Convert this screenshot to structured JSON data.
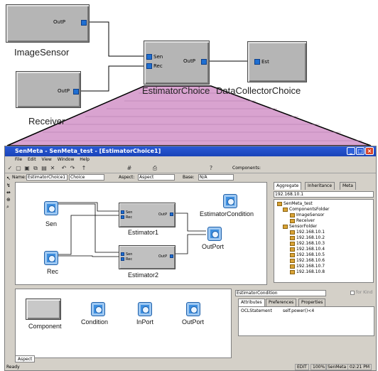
{
  "top_diagram": {
    "image_sensor": {
      "port": "OutP",
      "label": "ImageSensor"
    },
    "receiver": {
      "port": "OutP",
      "label": "Receiver"
    },
    "estimator_choice": {
      "ports_in": [
        "Sen",
        "Rec"
      ],
      "port_out": "OutP",
      "label": "EstimatorChoice"
    },
    "data_collector": {
      "port": "Est",
      "label": "DataCollectorChoice"
    }
  },
  "window": {
    "title": "SenMeta - SenMeta_test - [EstimatorChoice1]",
    "menu": [
      "File",
      "Edit",
      "View",
      "Window",
      "Help"
    ],
    "components_label": "Components:",
    "name_label": "Name:",
    "name_value": "EstimatorChoice1",
    "kind_value": "Choice",
    "aspect_label": "Aspect:",
    "aspect_value": "Aspect",
    "base_label": "Base:",
    "base_value": "N/A"
  },
  "canvas": {
    "nodes": [
      {
        "label": "Sen"
      },
      {
        "label": "Rec"
      },
      {
        "label": "EstimatorCondition"
      },
      {
        "label": "OutPort"
      }
    ],
    "estimator1": {
      "label": "Estimator1",
      "in": [
        "Sen",
        "Rec"
      ],
      "out": "OutP"
    },
    "estimator2": {
      "label": "Estimator2",
      "in": [
        "Sen",
        "Rec"
      ],
      "out": "OutP"
    }
  },
  "right_panel": {
    "tabs": [
      "Aggregate",
      "Inheritance",
      "Meta"
    ],
    "ip_select": "192.168.10.1",
    "tree": [
      "SenMeta_test",
      "ComponentsFolder",
      "ImageSensor",
      "Receiver",
      "SensorFolder",
      "192.168.10.1",
      "192.168.10.2",
      "192.168.10.3",
      "192.168.10.4",
      "192.168.10.5",
      "192.168.10.6",
      "192.168.10.7",
      "192.168.10.8"
    ]
  },
  "parts": {
    "items": [
      "Component",
      "Condition",
      "InPort",
      "OutPort"
    ],
    "tab": "Aspect"
  },
  "attributes": {
    "name": "EstimatorCondition",
    "for_kind": "for Kind",
    "tabs": [
      "Attributes",
      "Preferences",
      "Properties"
    ],
    "key": "OCLStatement",
    "value": "self.power()<4"
  },
  "status": {
    "text": "Ready",
    "mode": "EDIT",
    "zoom": "100%",
    "app": "SenMeta",
    "time": "02:21 PM"
  },
  "colors": {
    "accent": "#1f6fd1",
    "title_bar": "#1943b8",
    "zoom_fill": "#d9a3d0"
  }
}
